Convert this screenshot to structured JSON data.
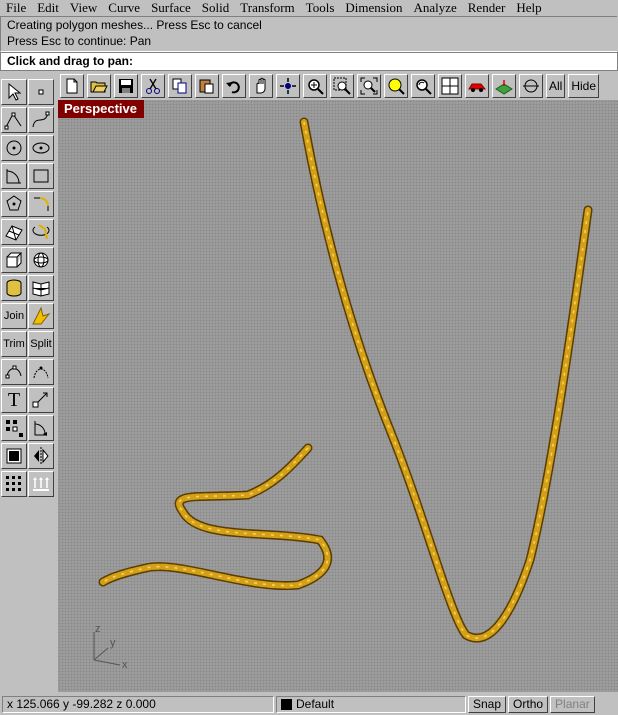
{
  "menu": [
    "File",
    "Edit",
    "View",
    "Curve",
    "Surface",
    "Solid",
    "Transform",
    "Tools",
    "Dimension",
    "Analyze",
    "Render",
    "Help"
  ],
  "command_history": [
    "Creating polygon meshes... Press Esc to cancel",
    "Press Esc to continue: Pan"
  ],
  "prompt": "Click and drag to pan:",
  "toolbar_top": {
    "icons": [
      "new-icon",
      "open-icon",
      "save-icon",
      "cut-icon",
      "copy-icon",
      "paste-icon",
      "undo-icon",
      "pan-hand-icon",
      "rotate-view-icon",
      "zoom-dynamic-icon",
      "zoom-window-icon",
      "zoom-extents-icon",
      "zoom-selected-icon",
      "undo-view-icon",
      "four-viewports-icon",
      "render-icon",
      "render-preview-icon",
      "osnap-icon"
    ],
    "all_label": "All",
    "hide_label": "Hide"
  },
  "toolbar_left": {
    "join_label": "Join",
    "trim_label": "Trim",
    "split_label": "Split",
    "text_label": "T"
  },
  "viewport": {
    "label": "Perspective",
    "axes": {
      "x": "x",
      "y": "y",
      "z": "z"
    },
    "chain_color": "#d4a017"
  },
  "status": {
    "coords": "x  125.066   y  -99.282    z  0.000",
    "layer": "Default",
    "snap": "Snap",
    "ortho": "Ortho",
    "planar": "Planar"
  }
}
